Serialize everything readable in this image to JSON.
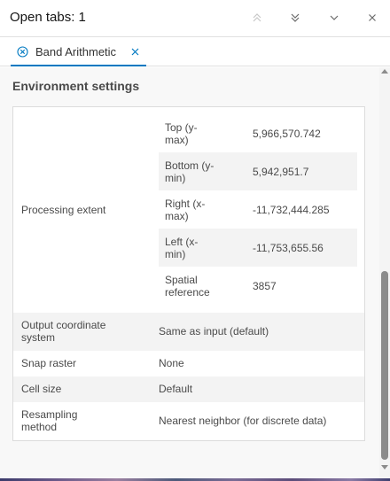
{
  "header": {
    "title": "Open tabs: 1"
  },
  "tab": {
    "label": "Band Arithmetic"
  },
  "section": {
    "title": "Environment settings"
  },
  "processing_extent": {
    "label": "Processing extent",
    "items": [
      {
        "label": "Top (y-max)",
        "value": "5,966,570.742"
      },
      {
        "label": "Bottom (y-min)",
        "value": "5,942,951.7"
      },
      {
        "label": "Right (x-max)",
        "value": "-11,732,444.285"
      },
      {
        "label": "Left (x-min)",
        "value": "-11,753,655.56"
      },
      {
        "label": "Spatial reference",
        "value": "3857"
      }
    ]
  },
  "settings": [
    {
      "label": "Output coordinate system",
      "value": "Same as input (default)"
    },
    {
      "label": "Snap raster",
      "value": "None"
    },
    {
      "label": "Cell size",
      "value": "Default"
    },
    {
      "label": "Resampling method",
      "value": "Nearest neighbor (for discrete data)"
    }
  ],
  "colors": {
    "accent": "#0079c1",
    "row_shade": "#f3f3f3",
    "panel_bg": "#f8f8f8"
  }
}
